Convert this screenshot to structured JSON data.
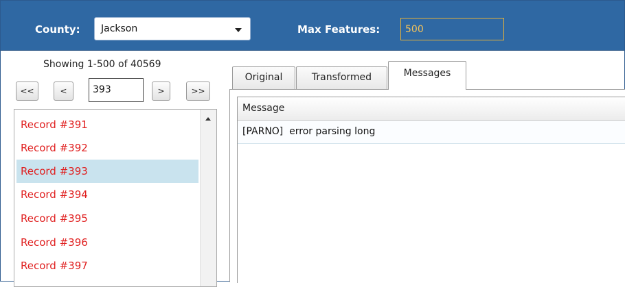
{
  "toolbar": {
    "county_label": "County:",
    "county_value": "Jackson",
    "max_features_label": "Max Features:",
    "max_features_value": "500"
  },
  "pager": {
    "showing_text": "Showing 1-500 of 40569",
    "first_label": "<<",
    "prev_label": "<",
    "page_value": "393",
    "next_label": ">",
    "last_label": ">>"
  },
  "records": {
    "items": [
      {
        "label": "Record #391"
      },
      {
        "label": "Record #392"
      },
      {
        "label": "Record #393",
        "selected": true
      },
      {
        "label": "Record #394"
      },
      {
        "label": "Record #395"
      },
      {
        "label": "Record #396"
      },
      {
        "label": "Record #397"
      }
    ]
  },
  "tabs": [
    {
      "label": "Original"
    },
    {
      "label": "Transformed"
    },
    {
      "label": "Messages",
      "active": true
    }
  ],
  "messages_grid": {
    "header": "Message",
    "rows": [
      "[PARNO]  error parsing long"
    ]
  },
  "colors": {
    "toolbar_bg": "#2f68a3",
    "record_text": "#e02020",
    "selected_row": "#c9e3ee",
    "max_features_border": "#e6b23a"
  }
}
